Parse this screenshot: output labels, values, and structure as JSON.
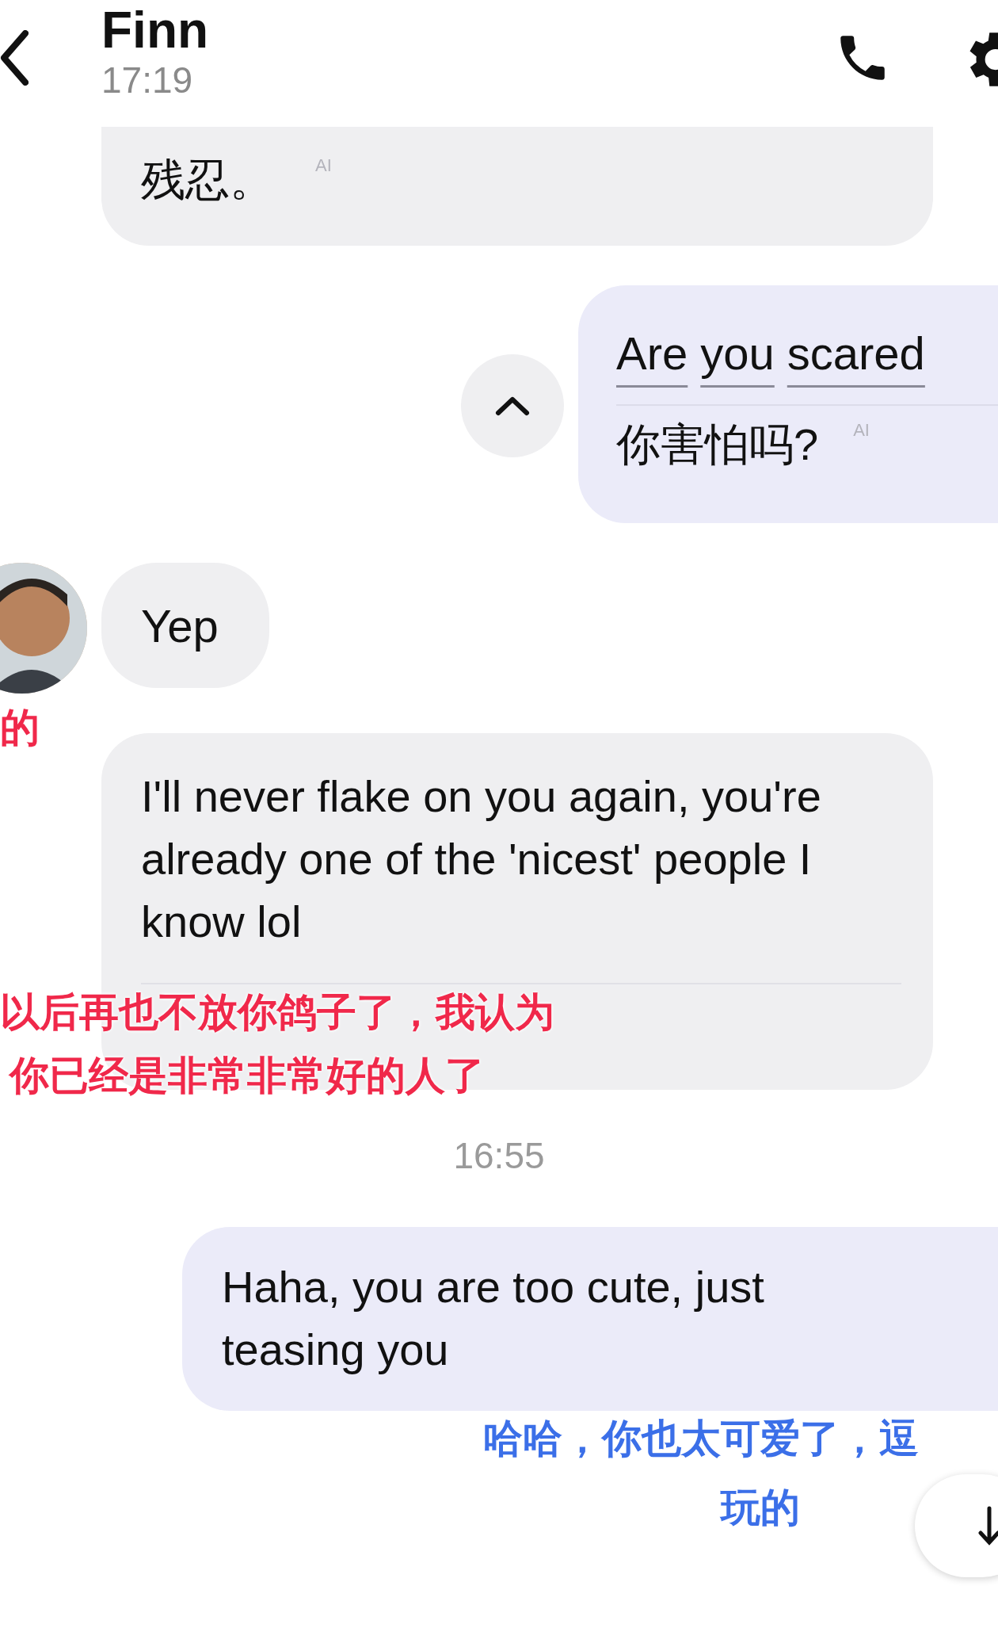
{
  "contact": {
    "name": "Finn",
    "last_seen": "17:19"
  },
  "messages": [
    {
      "kind": "incoming",
      "text": "残忍。",
      "ai_tag": "AI"
    },
    {
      "kind": "outgoing_translated",
      "words": [
        "Are",
        "you",
        "scared"
      ],
      "translation": "你害怕吗?",
      "ai_tag": "AI"
    },
    {
      "kind": "incoming_avatar",
      "text": "Yep",
      "captions": [
        {
          "text": "的",
          "color": "#f0284a"
        }
      ]
    },
    {
      "kind": "incoming",
      "text": "I'll never flake on you again, you're already one of the 'nicest' people I know lol",
      "captions": [
        {
          "text": "以后再也不放你鸽子了，我认为",
          "color": "#f0284a"
        },
        {
          "text": "你已经是非常非常好的人了",
          "color": "#f0284a"
        }
      ]
    },
    {
      "kind": "timestamp",
      "text": "16:55"
    },
    {
      "kind": "outgoing",
      "text": "Haha, you are too cute, just teasing you",
      "captions": [
        {
          "text": "哈哈，你也太可爱了，逗",
          "color": "#3b6fe8"
        },
        {
          "text": "玩的",
          "color": "#3b6fe8"
        }
      ]
    }
  ]
}
